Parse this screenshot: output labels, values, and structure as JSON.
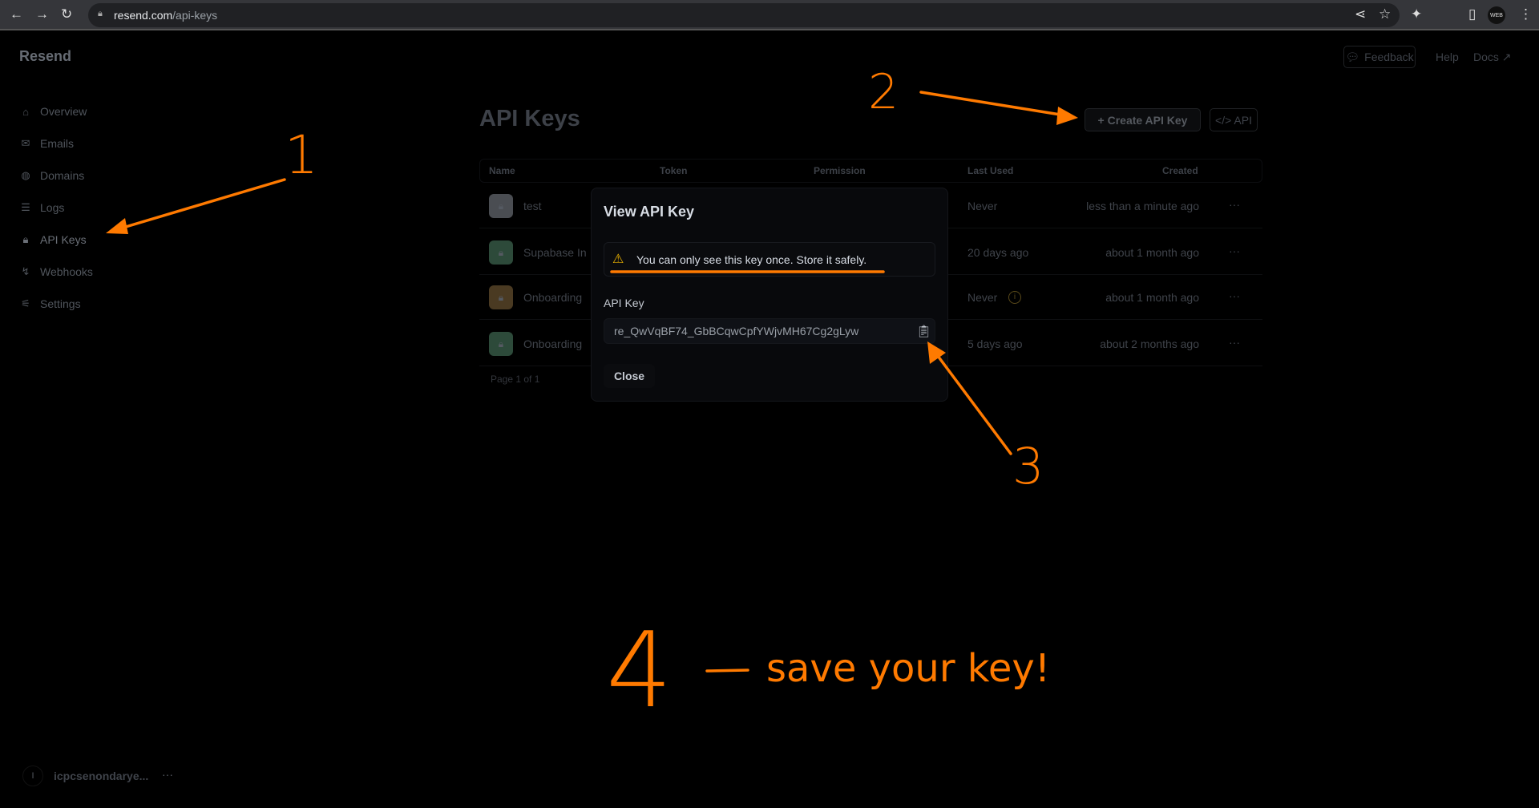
{
  "browser": {
    "url_host": "resend.com",
    "url_path": "/api-keys",
    "profile_badge": "WEB"
  },
  "app": {
    "logo": "Resend"
  },
  "sidebar": {
    "items": [
      {
        "label": "Overview",
        "icon": "home-icon"
      },
      {
        "label": "Emails",
        "icon": "mail-icon"
      },
      {
        "label": "Domains",
        "icon": "globe-icon"
      },
      {
        "label": "Logs",
        "icon": "list-icon"
      },
      {
        "label": "API Keys",
        "icon": "lock-icon"
      },
      {
        "label": "Webhooks",
        "icon": "webhook-icon"
      },
      {
        "label": "Settings",
        "icon": "sliders-icon"
      }
    ],
    "account": {
      "initial": "I",
      "name": "icpcsenondarye...",
      "more": "···"
    }
  },
  "topnav": {
    "feedback": "Feedback",
    "help": "Help",
    "docs": "Docs ↗"
  },
  "page": {
    "title": "API Keys",
    "create_button": "+ Create API Key",
    "api_button": "</> API"
  },
  "table": {
    "headers": [
      "Name",
      "Token",
      "Permission",
      "Last Used",
      "Created"
    ],
    "rows": [
      {
        "name": "test",
        "last_used": "Never",
        "created": "less than a minute ago",
        "icon_color": "#4a4d52"
      },
      {
        "name": "Supabase In",
        "last_used": "20 days ago",
        "created": "about 1 month ago",
        "icon_color": "#2d4a3a"
      },
      {
        "name": "Onboarding",
        "last_used": "Never",
        "created": "about 1 month ago",
        "icon_color": "#4a3a22"
      },
      {
        "name": "Onboarding",
        "last_used": "5 days ago",
        "created": "about 2 months ago",
        "icon_color": "#2d4a3a"
      }
    ],
    "more": "···",
    "pagination": "Page 1 of 1"
  },
  "modal": {
    "title": "View API Key",
    "warning": "You can only see this key once. Store it safely.",
    "key_label": "API Key",
    "key_value": "re_QwVqBF74_GbBCqwCpfYWjvMH67Cg2gLyw",
    "close": "Close"
  },
  "annotations": {
    "color": "#ff7a00",
    "step1": "1",
    "step2": "2",
    "step3": "3",
    "step4": "4",
    "step4_text": "save your key!"
  }
}
